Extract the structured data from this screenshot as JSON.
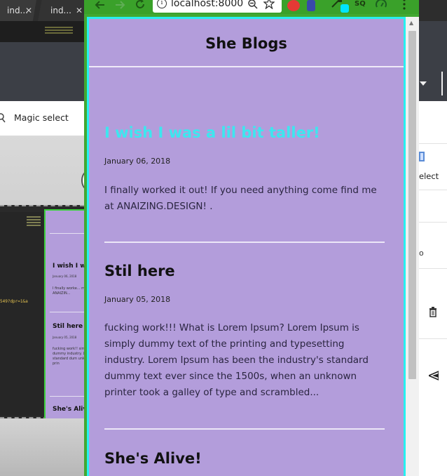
{
  "background_window": {
    "tabs": [
      {
        "label": "ind...",
        "close": "✕"
      },
      {
        "label": "ind...",
        "close": "✕"
      }
    ],
    "toolbar_label": "Magic select",
    "right_panel_label": "elect",
    "right_panel_small": "o",
    "code_snippet": "549?dpr=1&a",
    "mini_page": {
      "post1_title": "I wish I w",
      "post1_date": "January 06, 2018",
      "post1_body": "I finally worke... me at ANAIZIN...",
      "post2_title": "Stil here",
      "post2_date": "January 05, 2018",
      "post2_body": "fucking work!! simply dummy industry. Lore standard dum unknown prin",
      "post3_title": "She's Aliv"
    }
  },
  "browser": {
    "url": "localhost:8000",
    "ext_sq_label": "SQ"
  },
  "site": {
    "title": "She Blogs",
    "posts": [
      {
        "title": "I wish I was a lil bit taller!",
        "date": "January 06, 2018",
        "excerpt": "I finally worked it out! If you need anything come find me at ANAIZING.DESIGN! ."
      },
      {
        "title": "Stil here",
        "date": "January 05, 2018",
        "excerpt": "fucking work!!! What is Lorem Ipsum? Lorem Ipsum is simply dummy text of the printing and typesetting industry. Lorem Ipsum has been the industry's standard dummy text ever since the 1500s, when an unknown printer took a galley of type and scrambled..."
      },
      {
        "title": "She's Alive!"
      }
    ]
  },
  "colors": {
    "page_bg": "#b39ddb",
    "page_border": "#27f0f0",
    "browser_frame": "#42a832",
    "highlight_title": "#3ee6ef"
  }
}
